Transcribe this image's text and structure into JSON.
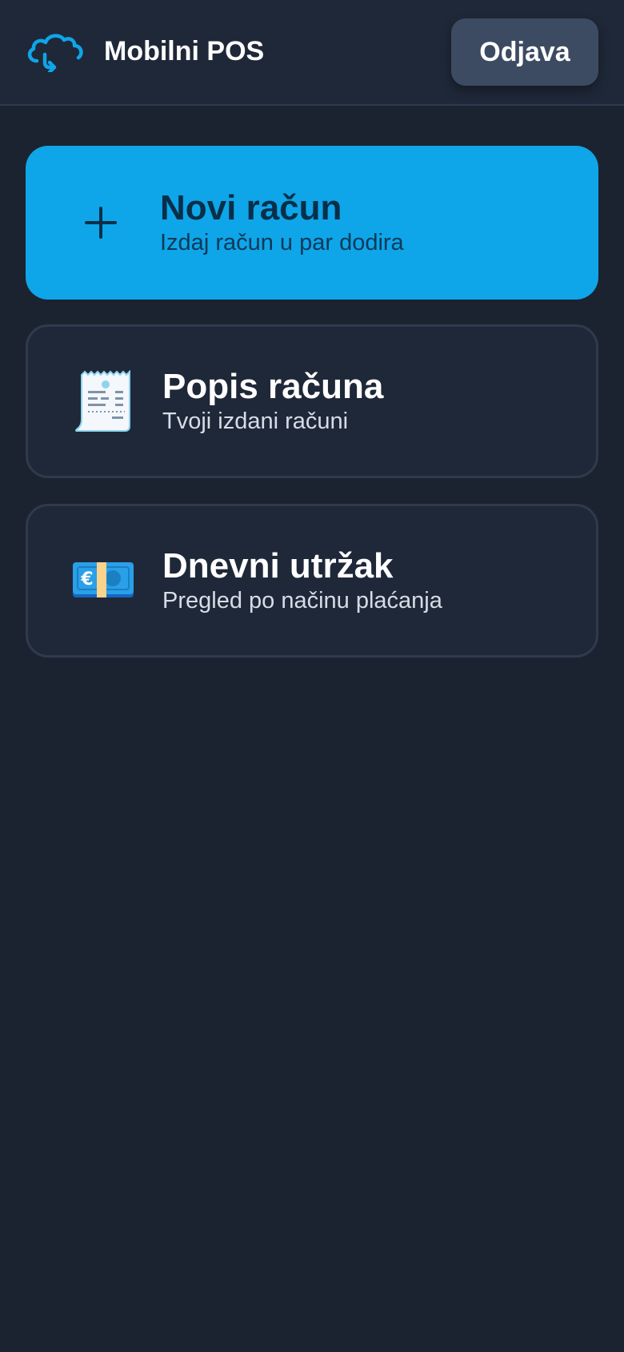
{
  "header": {
    "app_title": "Mobilni POS",
    "logout_label": "Odjava",
    "logo_icon": "cloud-sync-icon"
  },
  "colors": {
    "background": "#1b2330",
    "header_bg": "#1f2838",
    "accent": "#0fa5e9",
    "logout_bg": "#3d4b62"
  },
  "menu": {
    "new_invoice": {
      "title": "Novi račun",
      "subtitle": "Izdaj račun u par dodira",
      "icon": "plus-icon"
    },
    "invoice_list": {
      "title": "Popis računa",
      "subtitle": "Tvoji izdani računi",
      "icon": "receipt-icon"
    },
    "daily_revenue": {
      "title": "Dnevni utržak",
      "subtitle": "Pregled po načinu plaćanja",
      "icon": "euro-banknote-icon"
    }
  }
}
